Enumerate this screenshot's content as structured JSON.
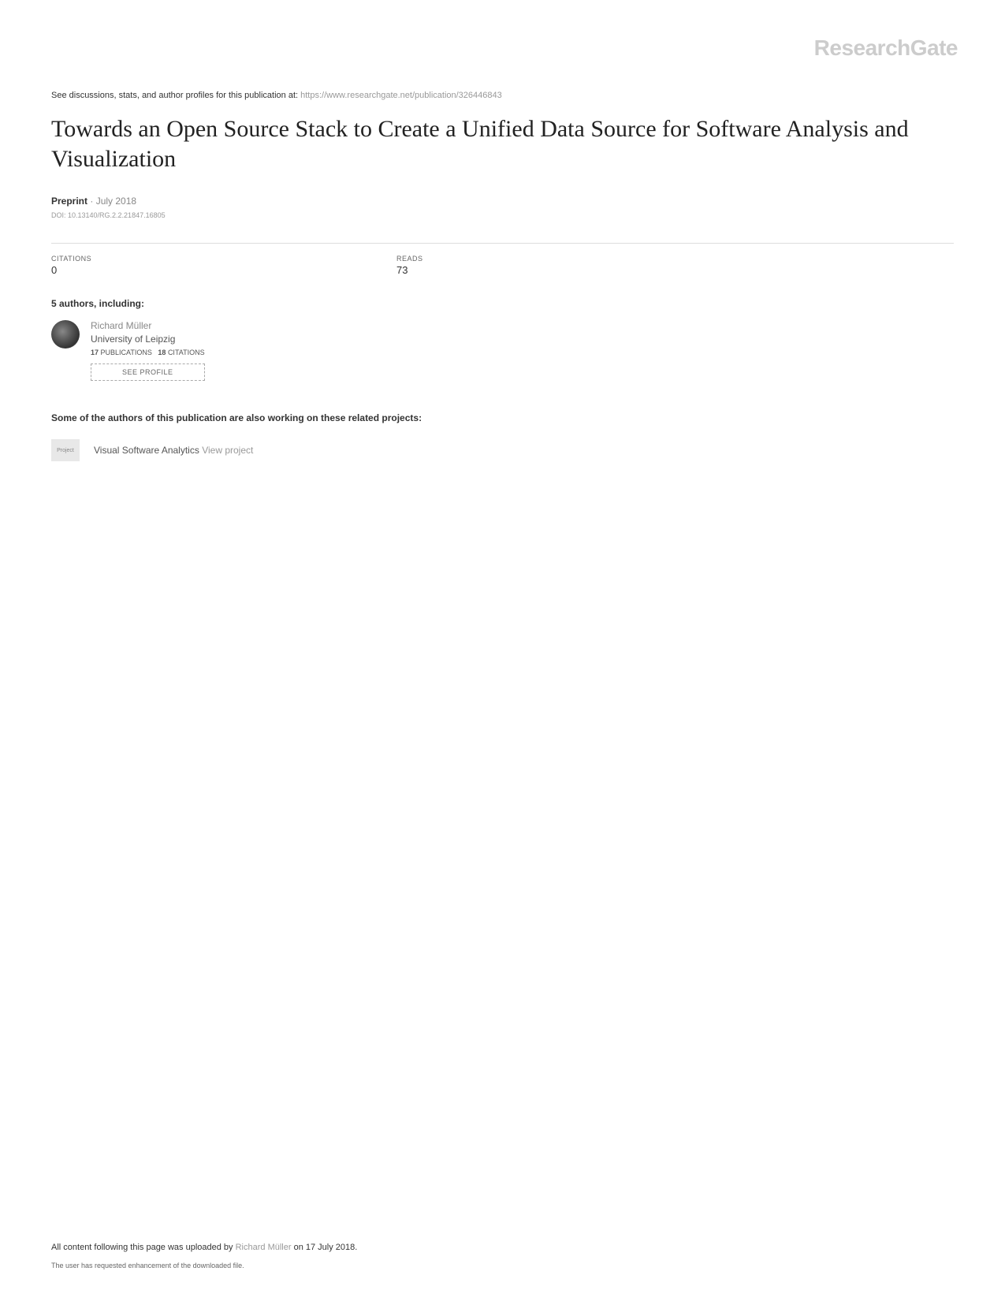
{
  "logo": "ResearchGate",
  "discussions_prefix": "See discussions, stats, and author profiles for this publication at: ",
  "discussions_url": "https://www.researchgate.net/publication/326446843",
  "title": "Towards an Open Source Stack to Create a Unified Data Source for Software Analysis and Visualization",
  "type_label": "Preprint",
  "date": "July 2018",
  "doi": "DOI: 10.13140/RG.2.2.21847.16805",
  "stats": {
    "citations_label": "CITATIONS",
    "citations_value": "0",
    "reads_label": "READS",
    "reads_value": "73"
  },
  "authors_heading": "5 authors, including:",
  "author": {
    "name": "Richard Müller",
    "affiliation": "University of Leipzig",
    "pubs_num": "17",
    "pubs_label": "PUBLICATIONS",
    "cites_num": "18",
    "cites_label": "CITATIONS",
    "see_profile": "SEE PROFILE"
  },
  "related_heading": "Some of the authors of this publication are also working on these related projects:",
  "project": {
    "badge": "Project",
    "name": "Visual Software Analytics ",
    "view": "View project"
  },
  "footer": {
    "prefix": "All content following this page was uploaded by ",
    "uploader": "Richard Müller",
    "suffix": " on 17 July 2018.",
    "sub": "The user has requested enhancement of the downloaded file."
  }
}
